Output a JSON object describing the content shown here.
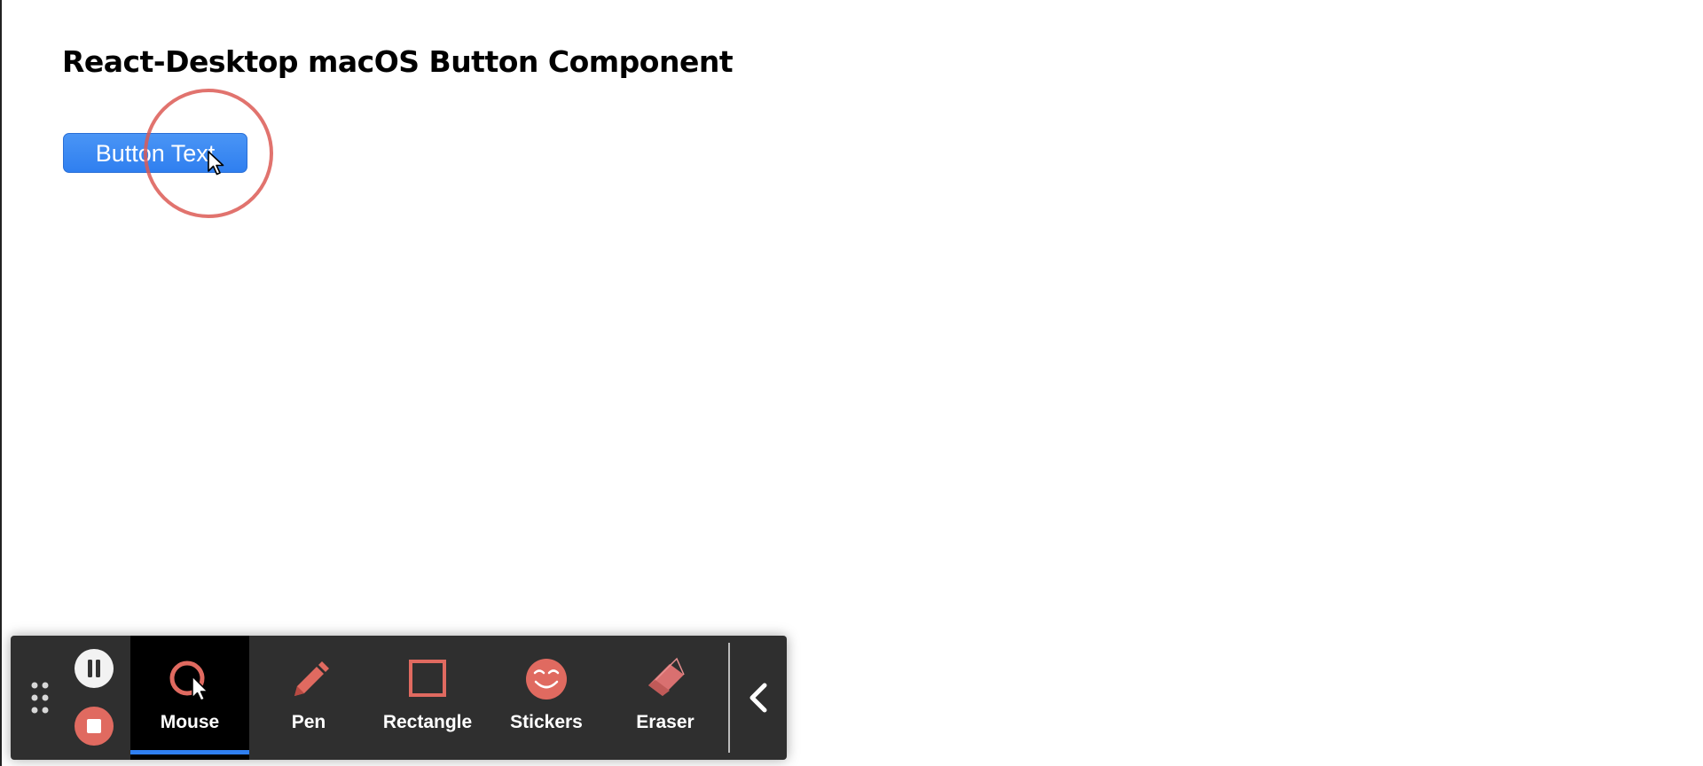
{
  "page": {
    "title": "React-Desktop macOS Button Component"
  },
  "demo_button": {
    "label": "Button Text",
    "color": "#2f7ff0"
  },
  "toolbar": {
    "pause_icon": "pause-icon",
    "stop_icon": "stop-icon",
    "active_tool": "Mouse",
    "accent_color": "#2f7ff0",
    "icon_color": "#e06a60",
    "tools": [
      {
        "label": "Mouse",
        "icon": "mouse-cursor-icon"
      },
      {
        "label": "Pen",
        "icon": "pen-icon"
      },
      {
        "label": "Rectangle",
        "icon": "rectangle-icon"
      },
      {
        "label": "Stickers",
        "icon": "sticker-face-icon"
      },
      {
        "label": "Eraser",
        "icon": "eraser-icon"
      }
    ],
    "collapse_icon": "chevron-left-icon"
  }
}
